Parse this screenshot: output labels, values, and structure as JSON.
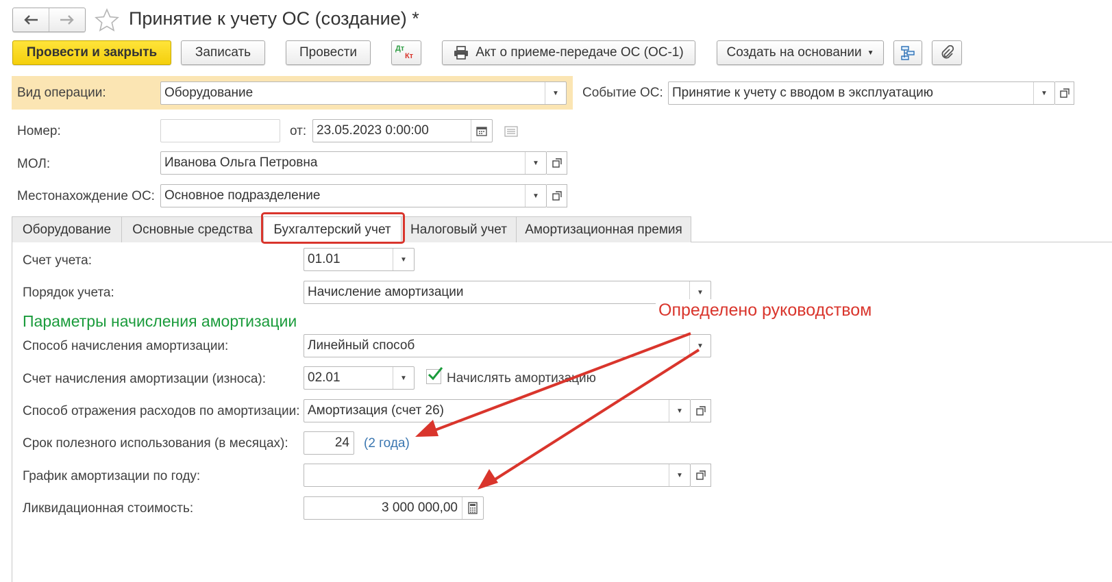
{
  "window": {
    "title": "Принятие к учету ОС (создание) *"
  },
  "toolbar": {
    "post_close": "Провести и закрыть",
    "save": "Записать",
    "post": "Провести",
    "dt_label": "Дт",
    "kt_label": "Кт",
    "act": "Акт о приеме-передаче ОС (ОС-1)",
    "create_based": "Создать на основании"
  },
  "header": {
    "op_type_label": "Вид операции:",
    "op_type_value": "Оборудование",
    "event_label": "Событие ОС:",
    "event_value": "Принятие к учету с вводом в эксплуатацию",
    "number_label": "Номер:",
    "number_value": "",
    "date_label": "от:",
    "date_value": "23.05.2023  0:00:00",
    "mol_label": "МОЛ:",
    "mol_value": "Иванова Ольга Петровна",
    "location_label": "Местонахождение ОС:",
    "location_value": "Основное подразделение"
  },
  "tabs": [
    {
      "label": "Оборудование"
    },
    {
      "label": "Основные средства"
    },
    {
      "label": "Бухгалтерский учет"
    },
    {
      "label": "Налоговый учет"
    },
    {
      "label": "Амортизационная премия"
    }
  ],
  "accounting": {
    "account_label": "Счет учета:",
    "account_value": "01.01",
    "order_label": "Порядок учета:",
    "order_value": "Начисление амортизации",
    "section_title": "Параметры начисления амортизации",
    "method_label": "Способ начисления амортизации:",
    "method_value": "Линейный способ",
    "dep_account_label": "Счет начисления амортизации (износа):",
    "dep_account_value": "02.01",
    "accrue_label": "Начислять амортизацию",
    "accrue_checked": true,
    "expense_label": "Способ отражения расходов по амортизации:",
    "expense_value": "Амортизация (счет 26)",
    "life_label": "Срок полезного использования (в месяцах):",
    "life_value": "24",
    "life_hint": "(2 года)",
    "schedule_label": "График амортизации по году:",
    "schedule_value": "",
    "salvage_label": "Ликвидационная стоимость:",
    "salvage_value": "3 000 000,00"
  },
  "annotation": {
    "text": "Определено руководством",
    "color": "#d9352c"
  },
  "colors": {
    "highlight_bg": "#fbe5b3",
    "primary_button": "#f6d312",
    "section_title": "#1a9b3b",
    "link": "#3a76b0",
    "active_tab_outline": "#d9352c"
  }
}
